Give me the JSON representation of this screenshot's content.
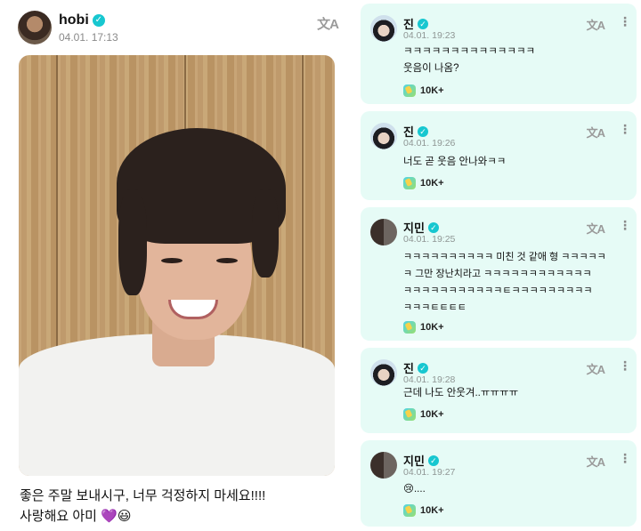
{
  "post": {
    "author": "hobi",
    "timestamp": "04.01. 17:13",
    "caption_lines": [
      "좋은 주말 보내시구, 너무 걱정하지 마세요!!!!",
      "사랑해요 아미"
    ],
    "caption_emojis": [
      "💜",
      "😃"
    ],
    "translate_icon": "文A"
  },
  "comments": [
    {
      "author": "진",
      "timestamp": "04.01. 19:23",
      "text": "ㅋㅋㅋㅋㅋㅋㅋㅋㅋㅋㅋㅋㅋㅋ\n웃음이 나옴?",
      "likes": "10K+",
      "avatar": "jin"
    },
    {
      "author": "진",
      "timestamp": "04.01. 19:26",
      "text": "너도 곧 웃음 안나와ㅋㅋ",
      "likes": "10K+",
      "avatar": "jin"
    },
    {
      "author": "지민",
      "timestamp": "04.01. 19:25",
      "text": "ㅋㅋㅋㅋㅋㅋㅋㅋㅋㅋ 미친 것 같애 형 ㅋㅋㅋㅋㅋ\nㅋ 그만 장난치라고 ㅋㅋㅋㅋㅋㅋㅋㅋㅋㅋㅋㅋ\nㅋㅋㅋㅋㅋㅋㅋㅋㅋㅋㅋㅌㅋㅋㅋㅋㅋㅋㅋㅋㅋ\nㅋㅋㅋㅌㅌㅌㅌ",
      "likes": "10K+",
      "avatar": "jimin"
    },
    {
      "author": "진",
      "timestamp": "04.01. 19:28",
      "text": "근데 나도 안웃겨..ㅠㅠㅠㅠ",
      "likes": "10K+",
      "avatar": "jin"
    },
    {
      "author": "지민",
      "timestamp": "04.01. 19:27",
      "text": "😢....",
      "likes": "10K+",
      "avatar": "jimin"
    }
  ],
  "icons": {
    "verified": "✓",
    "more": "⋮"
  }
}
